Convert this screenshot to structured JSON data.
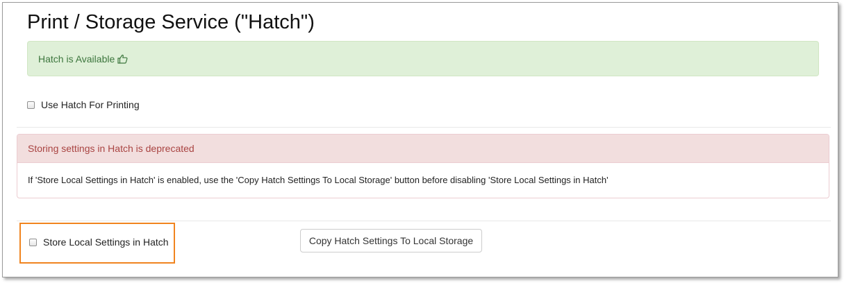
{
  "page": {
    "title": "Print / Storage Service (\"Hatch\")"
  },
  "status_alert": {
    "text": "Hatch is Available",
    "icon": "thumbs-up-icon",
    "color": "#3c763d",
    "background": "#dff0d8"
  },
  "print_option": {
    "label": "Use Hatch For Printing",
    "checked": false
  },
  "deprecation_panel": {
    "heading": "Storing settings in Hatch is deprecated",
    "body": "If 'Store Local Settings in Hatch' is enabled, use the 'Copy Hatch Settings To Local Storage' button before disabling 'Store Local Settings in Hatch'",
    "heading_color": "#a94442",
    "heading_background": "#f2dede"
  },
  "storage_option": {
    "label": "Store Local Settings in Hatch",
    "checked": false,
    "highlight_color": "#f0841f"
  },
  "copy_button": {
    "label": "Copy Hatch Settings To Local Storage"
  }
}
